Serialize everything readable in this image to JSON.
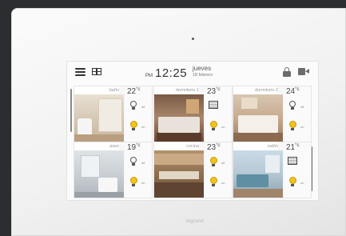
{
  "device": {
    "brand": "legrand"
  },
  "topbar": {
    "ampm": "PM",
    "time": "12:25",
    "day": "jueves",
    "date": "18 febrero"
  },
  "icons": {
    "menu": "hamburger-menu-icon",
    "view": "grid-view-icon",
    "lock": "lock-icon",
    "camera": "video-camera-icon"
  },
  "rooms": [
    {
      "name": "baño",
      "temp": "22",
      "unit": "°c",
      "off_label": "off",
      "on_label": "on"
    },
    {
      "name": "dormitorio 1",
      "temp": "23",
      "unit": "°c",
      "off_label": "",
      "on_label": "on"
    },
    {
      "name": "dormitorio 2",
      "temp": "24",
      "unit": "°c",
      "off_label": "off",
      "on_label": "on"
    },
    {
      "name": "aseo",
      "temp": "19",
      "unit": "°c",
      "off_label": "off",
      "on_label": "on"
    },
    {
      "name": "cocina",
      "temp": "23",
      "unit": "°c",
      "off_label": "off",
      "on_label": "on"
    },
    {
      "name": "salón",
      "temp": "21",
      "unit": "°c",
      "off_label": "",
      "on_label": "on"
    }
  ],
  "colors": {
    "bulb_on": "#f0c419",
    "frame": "#f4f4f4",
    "background": "#2b2d31"
  }
}
